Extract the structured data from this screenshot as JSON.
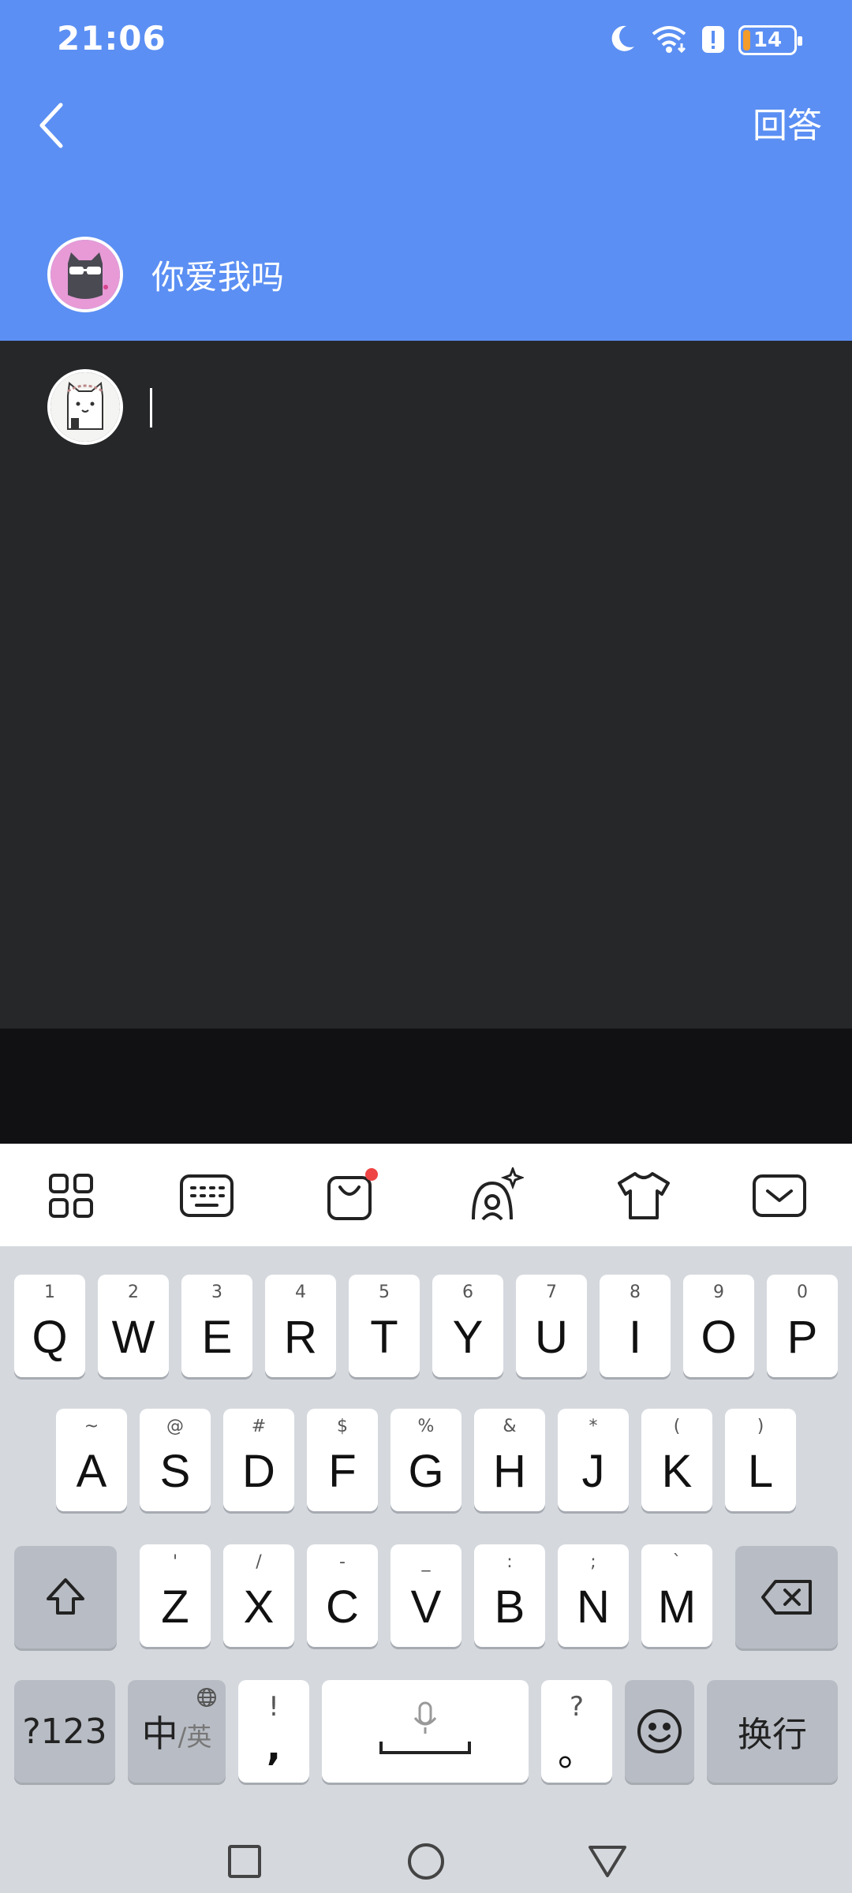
{
  "status_bar": {
    "time": "21:06",
    "battery": "14",
    "battery_level_percent": 14
  },
  "nav": {
    "answer_label": "回答"
  },
  "question": {
    "text": "你爱我吗"
  },
  "reply": {
    "value": "",
    "placeholder": ""
  },
  "keyboard": {
    "toolbar": [
      "apps-icon",
      "keyboard-icon",
      "shop-icon",
      "ai-icon",
      "skin-icon",
      "collapse-keyboard-icon"
    ],
    "row1": [
      {
        "k": "Q",
        "h": "1"
      },
      {
        "k": "W",
        "h": "2"
      },
      {
        "k": "E",
        "h": "3"
      },
      {
        "k": "R",
        "h": "4"
      },
      {
        "k": "T",
        "h": "5"
      },
      {
        "k": "Y",
        "h": "6"
      },
      {
        "k": "U",
        "h": "7"
      },
      {
        "k": "I",
        "h": "8"
      },
      {
        "k": "O",
        "h": "9"
      },
      {
        "k": "P",
        "h": "0"
      }
    ],
    "row2": [
      {
        "k": "A",
        "h": "~"
      },
      {
        "k": "S",
        "h": "@"
      },
      {
        "k": "D",
        "h": "#"
      },
      {
        "k": "F",
        "h": "$"
      },
      {
        "k": "G",
        "h": "%"
      },
      {
        "k": "H",
        "h": "&"
      },
      {
        "k": "J",
        "h": "*"
      },
      {
        "k": "K",
        "h": "("
      },
      {
        "k": "L",
        "h": ")"
      }
    ],
    "row3": [
      {
        "k": "Z",
        "h": "'"
      },
      {
        "k": "X",
        "h": "/"
      },
      {
        "k": "C",
        "h": "-"
      },
      {
        "k": "V",
        "h": "_"
      },
      {
        "k": "B",
        "h": ":"
      },
      {
        "k": "N",
        "h": ";"
      },
      {
        "k": "M",
        "h": "`"
      }
    ],
    "sym_label": "?123",
    "lang_main": "中",
    "lang_alt": "/英",
    "comma_main": ",",
    "comma_hint": "!",
    "period_main": "。",
    "period_hint": "?",
    "enter_label": "换行"
  }
}
